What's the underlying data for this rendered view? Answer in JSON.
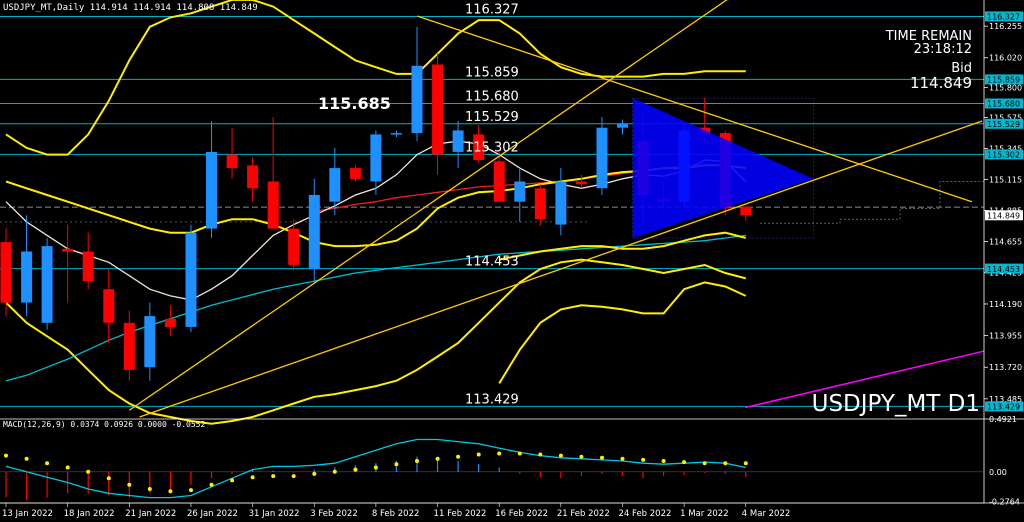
{
  "chart_data": {
    "type": "candlestick",
    "header_text": "USDJPY_MT,Daily  114.914 114.914 114.808 114.849",
    "symbol_label": "USDJPY_MT D1",
    "info": {
      "time_remain_label": "TIME REMAIN",
      "time_remain": "23:18:12",
      "bid_label": "Bid",
      "bid": "114.849"
    },
    "price_axis": {
      "ylim": [
        113.35,
        116.36
      ],
      "ticks": [
        116.255,
        116.02,
        115.8,
        115.575,
        115.345,
        115.115,
        114.885,
        114.655,
        114.425,
        114.19,
        113.955,
        113.72,
        113.485
      ],
      "tick_labels": [
        "116.255",
        "116.020",
        "115.800",
        "115.575",
        "115.345",
        "115.115",
        "114.885",
        "114.655",
        "114.425",
        "114.190",
        "113.955",
        "113.720",
        "113.485"
      ]
    },
    "levels": [
      {
        "value": 116.327,
        "label": "116.327",
        "tag": "116.327"
      },
      {
        "value": 115.859,
        "label": "115.859",
        "tag": "115.859"
      },
      {
        "value": 115.68,
        "label": "115.680",
        "tag": "115.680"
      },
      {
        "value": 115.529,
        "label": "115.529",
        "tag": "115.529"
      },
      {
        "value": 115.302,
        "label": "115.302",
        "tag": "115.302"
      },
      {
        "value": 114.453,
        "label": "114.453",
        "tag": "114.453"
      },
      {
        "value": 113.429,
        "label": "113.429",
        "tag": "113.429"
      }
    ],
    "bid_tag": "114.849",
    "bid_value": 114.849,
    "big_label": {
      "text": "115.685",
      "value": 115.685
    },
    "x_labels": [
      "13 Jan 2022",
      "18 Jan 2022",
      "21 Jan 2022",
      "26 Jan 2022",
      "31 Jan 2022",
      "3 Feb 2022",
      "8 Feb 2022",
      "11 Feb 2022",
      "16 Feb 2022",
      "21 Feb 2022",
      "24 Feb 2022",
      "1 Mar 2022",
      "4 Mar 2022"
    ],
    "candles": [
      {
        "o": 114.65,
        "h": 114.75,
        "l": 114.1,
        "c": 114.2
      },
      {
        "o": 114.2,
        "h": 114.85,
        "l": 114.1,
        "c": 114.58
      },
      {
        "o": 114.05,
        "h": 114.68,
        "l": 114.0,
        "c": 114.62
      },
      {
        "o": 114.6,
        "h": 114.78,
        "l": 114.2,
        "c": 114.58
      },
      {
        "o": 114.58,
        "h": 114.72,
        "l": 114.3,
        "c": 114.36
      },
      {
        "o": 114.3,
        "h": 114.45,
        "l": 113.9,
        "c": 114.05
      },
      {
        "o": 114.05,
        "h": 114.14,
        "l": 113.62,
        "c": 113.7
      },
      {
        "o": 113.72,
        "h": 114.2,
        "l": 113.62,
        "c": 114.1
      },
      {
        "o": 114.08,
        "h": 114.18,
        "l": 113.95,
        "c": 114.02
      },
      {
        "o": 114.02,
        "h": 114.78,
        "l": 113.98,
        "c": 114.72
      },
      {
        "o": 114.75,
        "h": 115.55,
        "l": 114.68,
        "c": 115.32
      },
      {
        "o": 115.3,
        "h": 115.5,
        "l": 115.12,
        "c": 115.2
      },
      {
        "o": 115.22,
        "h": 115.28,
        "l": 114.95,
        "c": 115.05
      },
      {
        "o": 115.1,
        "h": 115.58,
        "l": 114.8,
        "c": 114.75
      },
      {
        "o": 114.75,
        "h": 114.82,
        "l": 114.44,
        "c": 114.48
      },
      {
        "o": 114.45,
        "h": 115.12,
        "l": 114.35,
        "c": 115.0
      },
      {
        "o": 114.95,
        "h": 115.35,
        "l": 114.85,
        "c": 115.2
      },
      {
        "o": 115.2,
        "h": 115.22,
        "l": 115.1,
        "c": 115.12
      },
      {
        "o": 115.1,
        "h": 115.48,
        "l": 115.0,
        "c": 115.45
      },
      {
        "o": 115.45,
        "h": 115.48,
        "l": 115.43,
        "c": 115.46
      },
      {
        "o": 115.46,
        "h": 116.25,
        "l": 115.4,
        "c": 115.96
      },
      {
        "o": 115.97,
        "h": 116.05,
        "l": 115.15,
        "c": 115.3
      },
      {
        "o": 115.32,
        "h": 115.55,
        "l": 115.2,
        "c": 115.48
      },
      {
        "o": 115.45,
        "h": 115.52,
        "l": 115.24,
        "c": 115.26
      },
      {
        "o": 115.25,
        "h": 115.32,
        "l": 114.95,
        "c": 114.95
      },
      {
        "o": 114.95,
        "h": 115.2,
        "l": 114.8,
        "c": 115.1
      },
      {
        "o": 115.05,
        "h": 115.08,
        "l": 114.77,
        "c": 114.82
      },
      {
        "o": 114.78,
        "h": 115.2,
        "l": 114.7,
        "c": 115.1
      },
      {
        "o": 115.1,
        "h": 115.15,
        "l": 115.05,
        "c": 115.08
      },
      {
        "o": 115.05,
        "h": 115.58,
        "l": 115.0,
        "c": 115.5
      },
      {
        "o": 115.5,
        "h": 115.56,
        "l": 115.45,
        "c": 115.53
      },
      {
        "o": 115.4,
        "h": 115.6,
        "l": 114.8,
        "c": 115.0
      },
      {
        "o": 114.97,
        "h": 115.1,
        "l": 114.88,
        "c": 114.95
      },
      {
        "o": 114.95,
        "h": 115.52,
        "l": 114.9,
        "c": 115.48
      },
      {
        "o": 115.5,
        "h": 115.72,
        "l": 115.4,
        "c": 115.46
      },
      {
        "o": 115.46,
        "h": 115.48,
        "l": 114.85,
        "c": 114.9
      },
      {
        "o": 114.914,
        "h": 114.914,
        "l": 114.808,
        "c": 114.849
      }
    ],
    "series": [
      {
        "kind": "ma",
        "color": "#ff2020",
        "values": [
          null,
          null,
          null,
          null,
          null,
          null,
          null,
          null,
          null,
          null,
          null,
          null,
          null,
          null,
          null,
          114.88,
          114.9,
          114.93,
          114.95,
          114.98,
          115.0,
          115.02,
          115.04,
          115.06,
          115.07,
          115.08,
          115.09,
          115.1,
          115.12,
          115.14,
          115.16,
          115.18,
          115.2,
          115.22,
          115.23,
          115.22,
          115.2
        ]
      },
      {
        "kind": "ma",
        "color": "#fff0e0",
        "values": [
          114.95,
          114.8,
          114.7,
          114.6,
          114.55,
          114.5,
          114.4,
          114.3,
          114.25,
          114.22,
          114.3,
          114.4,
          114.55,
          114.7,
          114.78,
          114.85,
          114.92,
          115.0,
          115.05,
          115.15,
          115.3,
          115.38,
          115.4,
          115.38,
          115.3,
          115.2,
          115.12,
          115.08,
          115.05,
          115.08,
          115.12,
          115.15,
          115.14,
          115.18,
          115.26,
          115.25,
          115.1
        ]
      },
      {
        "kind": "band",
        "color": "#ffee00",
        "values": [
          115.1,
          115.05,
          115.0,
          114.95,
          114.9,
          114.85,
          114.8,
          114.75,
          114.72,
          114.72,
          114.78,
          114.82,
          114.82,
          114.78,
          114.72,
          114.65,
          114.62,
          114.62,
          114.63,
          114.66,
          114.75,
          114.9,
          114.98,
          115.02,
          115.03,
          115.05,
          115.08,
          115.1,
          115.12,
          115.15,
          115.17,
          115.18,
          115.2,
          115.2,
          115.22,
          115.22,
          115.2
        ]
      },
      {
        "kind": "band",
        "color": "#ffee00",
        "values": [
          115.45,
          115.35,
          115.3,
          115.3,
          115.45,
          115.7,
          116.0,
          116.25,
          116.32,
          116.35,
          116.4,
          116.45,
          116.45,
          116.4,
          116.3,
          116.2,
          116.1,
          116.0,
          115.95,
          115.9,
          115.9,
          116.05,
          116.2,
          116.3,
          116.3,
          116.2,
          116.05,
          115.95,
          115.9,
          115.88,
          115.88,
          115.88,
          115.9,
          115.9,
          115.92,
          115.92,
          115.92
        ]
      },
      {
        "kind": "band",
        "color": "#ffee00",
        "values": [
          114.2,
          114.05,
          113.95,
          113.85,
          113.7,
          113.55,
          113.45,
          113.38,
          113.35,
          113.32,
          113.3,
          113.32,
          113.35,
          113.4,
          113.45,
          113.5,
          113.52,
          113.55,
          113.58,
          113.62,
          113.7,
          113.8,
          113.9,
          114.05,
          114.2,
          114.35,
          114.45,
          114.5,
          114.52,
          114.5,
          114.48,
          114.45,
          114.42,
          114.45,
          114.48,
          114.42,
          114.38
        ]
      },
      {
        "kind": "ma",
        "color": "#00c8d8",
        "values": [
          113.62,
          113.66,
          113.72,
          113.78,
          113.85,
          113.92,
          113.98,
          114.03,
          114.08,
          114.13,
          114.18,
          114.22,
          114.26,
          114.3,
          114.33,
          114.36,
          114.39,
          114.42,
          114.44,
          114.46,
          114.48,
          114.5,
          114.52,
          114.54,
          114.56,
          114.57,
          114.58,
          114.59,
          114.6,
          114.61,
          114.62,
          114.63,
          114.64,
          114.65,
          114.66,
          114.68,
          114.7
        ]
      },
      {
        "kind": "band",
        "color": "#ffee00",
        "values": [
          null,
          null,
          null,
          null,
          null,
          null,
          null,
          null,
          null,
          null,
          null,
          null,
          null,
          null,
          null,
          null,
          null,
          null,
          null,
          null,
          null,
          null,
          null,
          null,
          114.52,
          114.55,
          114.58,
          114.6,
          114.62,
          114.62,
          114.6,
          114.6,
          114.62,
          114.66,
          114.7,
          114.72,
          114.68
        ]
      },
      {
        "kind": "band",
        "color": "#ffee00",
        "values": [
          null,
          null,
          null,
          null,
          null,
          null,
          null,
          null,
          null,
          null,
          null,
          null,
          null,
          null,
          null,
          null,
          null,
          null,
          null,
          null,
          null,
          null,
          null,
          null,
          113.6,
          113.85,
          114.05,
          114.15,
          114.18,
          114.17,
          114.15,
          114.12,
          114.12,
          114.3,
          114.35,
          114.32,
          114.25
        ]
      }
    ],
    "macd": {
      "label": "MACD(12,26,9) 0.0374 0.0926 0.0000 -0.0552",
      "ylim": [
        -0.29,
        0.49
      ],
      "ticks": [
        0.4921,
        0.0,
        -0.2764
      ],
      "tick_labels": [
        "0.4921",
        "0.00",
        "-0.2764"
      ],
      "histogram": [
        -0.24,
        -0.26,
        -0.24,
        -0.2,
        -0.2,
        -0.22,
        -0.24,
        -0.2,
        -0.18,
        -0.12,
        -0.06,
        -0.02,
        0.02,
        0.01,
        -0.01,
        0.02,
        0.04,
        0.06,
        0.08,
        0.1,
        0.14,
        0.12,
        0.1,
        0.07,
        0.04,
        -0.02,
        -0.05,
        -0.06,
        -0.04,
        -0.02,
        -0.04,
        -0.06,
        -0.04,
        -0.03,
        -0.01,
        -0.02,
        -0.05
      ],
      "signal": [
        0.15,
        0.12,
        0.08,
        0.04,
        0.0,
        -0.06,
        -0.12,
        -0.16,
        -0.18,
        -0.17,
        -0.12,
        -0.08,
        -0.05,
        -0.04,
        -0.04,
        -0.02,
        0.0,
        0.02,
        0.04,
        0.07,
        0.1,
        0.12,
        0.14,
        0.16,
        0.17,
        0.17,
        0.16,
        0.15,
        0.14,
        0.13,
        0.12,
        0.11,
        0.1,
        0.09,
        0.08,
        0.08,
        0.08
      ],
      "macd_line": [
        0.05,
        0.0,
        -0.05,
        -0.1,
        -0.16,
        -0.2,
        -0.22,
        -0.24,
        -0.24,
        -0.22,
        -0.14,
        -0.06,
        0.02,
        0.05,
        0.05,
        0.06,
        0.08,
        0.14,
        0.2,
        0.26,
        0.3,
        0.3,
        0.28,
        0.26,
        0.22,
        0.18,
        0.15,
        0.13,
        0.12,
        0.11,
        0.1,
        0.08,
        0.07,
        0.08,
        0.09,
        0.08,
        0.04
      ]
    },
    "colors": {
      "bull": "#1e90ff",
      "bear": "#ff0000",
      "grid_level": "#00b0c8",
      "triangle": "#0000ff",
      "trend": "#ffcc00",
      "magenta": "#ff00ff",
      "text": "#ffffff"
    }
  }
}
